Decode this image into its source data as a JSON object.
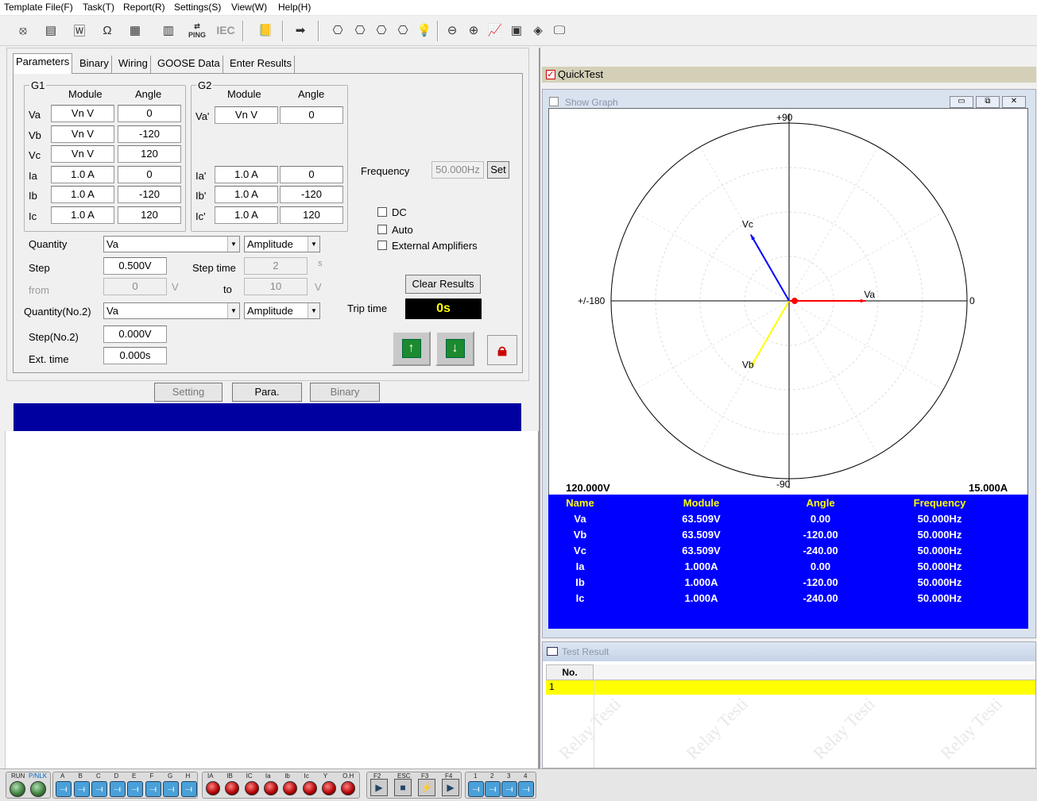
{
  "menu": [
    "Template File(F)",
    "Task(T)",
    "Report(R)",
    "Settings(S)",
    "View(W)",
    "Help(H)"
  ],
  "toolbar": {
    "ping": "PING",
    "iec": "IEC"
  },
  "tabs": [
    "Parameters",
    "Binary",
    "Wiring",
    "GOOSE Data",
    "Enter Results"
  ],
  "g1": {
    "title": "G1",
    "col_module": "Module",
    "col_angle": "Angle",
    "rows": [
      {
        "name": "Va",
        "module": "Vn V",
        "angle": "0"
      },
      {
        "name": "Vb",
        "module": "Vn V",
        "angle": "-120"
      },
      {
        "name": "Vc",
        "module": "Vn V",
        "angle": "120"
      },
      {
        "name": "Ia",
        "module": "1.0 A",
        "angle": "0"
      },
      {
        "name": "Ib",
        "module": "1.0 A",
        "angle": "-120"
      },
      {
        "name": "Ic",
        "module": "1.0 A",
        "angle": "120"
      }
    ]
  },
  "g2": {
    "title": "G2",
    "col_module": "Module",
    "col_angle": "Angle",
    "rows": [
      {
        "name": "Va'",
        "module": "Vn V",
        "angle": "0"
      },
      {
        "name": "Ia'",
        "module": "1.0 A",
        "angle": "0"
      },
      {
        "name": "Ib'",
        "module": "1.0 A",
        "angle": "-120"
      },
      {
        "name": "Ic'",
        "module": "1.0 A",
        "angle": "120"
      }
    ]
  },
  "frequency": {
    "label": "Frequency",
    "value": "50.000Hz",
    "set": "Set"
  },
  "checks": [
    {
      "label": "DC",
      "checked": false
    },
    {
      "label": "Auto",
      "checked": false
    },
    {
      "label": "External Amplifiers",
      "checked": false
    }
  ],
  "quantity": {
    "label": "Quantity",
    "value": "Va",
    "mode": "Amplitude"
  },
  "step": {
    "label": "Step",
    "value": "0.500V",
    "time_label": "Step time",
    "time_value": "2",
    "time_unit": "s"
  },
  "from": {
    "label": "from",
    "value": "0",
    "unit": "V",
    "to_label": "to",
    "to_value": "10",
    "to_unit": "V"
  },
  "quantity2": {
    "label": "Quantity(No.2)",
    "value": "Va",
    "mode": "Amplitude"
  },
  "step2": {
    "label": "Step(No.2)",
    "value": "0.000V"
  },
  "ext": {
    "label": "Ext. time",
    "value": "0.000s"
  },
  "clear_results": "Clear Results",
  "trip": {
    "label": "Trip time",
    "value": "0s"
  },
  "bottom_tabs": [
    "Setting",
    "Para.",
    "Binary"
  ],
  "quicktest": {
    "title": "QuickTest",
    "checked": true
  },
  "graph": {
    "title": "Show Graph",
    "top": "+90",
    "bottom": "-90",
    "left": "+/-180",
    "right": "0",
    "vscale": "120.000V",
    "iscale": "15.000A",
    "vectors": [
      {
        "name": "Va",
        "angle": 0,
        "mag": 0.43,
        "color": "#ff0000"
      },
      {
        "name": "Vb",
        "angle": -120,
        "mag": 0.43,
        "color": "#ffff00"
      },
      {
        "name": "Vc",
        "angle": 120,
        "mag": 0.43,
        "color": "#0000ff"
      }
    ]
  },
  "table": {
    "headers": [
      "Name",
      "Module",
      "Angle",
      "Frequency"
    ],
    "rows": [
      [
        "Va",
        "63.509V",
        "0.00",
        "50.000Hz"
      ],
      [
        "Vb",
        "63.509V",
        "-120.00",
        "50.000Hz"
      ],
      [
        "Vc",
        "63.509V",
        "-240.00",
        "50.000Hz"
      ],
      [
        "Ia",
        "1.000A",
        "0.00",
        "50.000Hz"
      ],
      [
        "Ib",
        "1.000A",
        "-120.00",
        "50.000Hz"
      ],
      [
        "Ic",
        "1.000A",
        "-240.00",
        "50.000Hz"
      ]
    ]
  },
  "result": {
    "title": "Test Result",
    "col_no": "No.",
    "rows": [
      "1"
    ],
    "watermark": "Relay Testi"
  },
  "status": {
    "run": "RUN",
    "pnlk": "P/NLK",
    "binary": [
      "A",
      "B",
      "C",
      "D",
      "E",
      "F",
      "G",
      "H"
    ],
    "outputs": [
      "IA",
      "IB",
      "IC",
      "Ia",
      "Ib",
      "Ic",
      "Y",
      "O.H"
    ],
    "keys": [
      "F2",
      "ESC",
      "F3",
      "F4"
    ],
    "nums": [
      "1",
      "2",
      "3",
      "4"
    ]
  }
}
